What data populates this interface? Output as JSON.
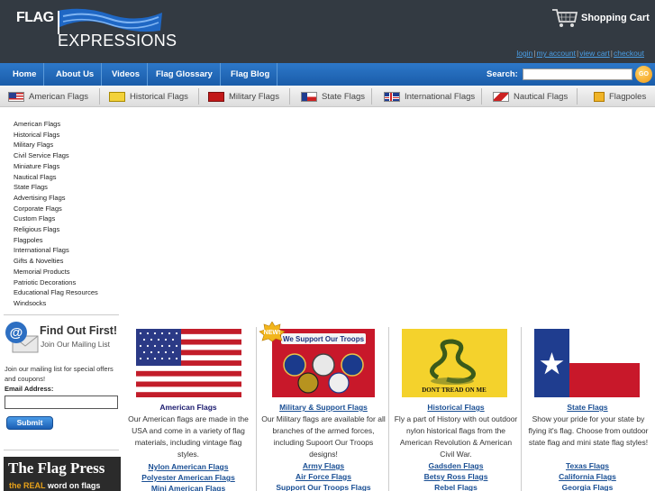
{
  "header": {
    "logo_top": "FLAG",
    "logo_bottom": "EXPRESSIONS",
    "cart_label": "Shopping Cart",
    "links": [
      "login",
      "my account",
      "view cart",
      "checkout"
    ]
  },
  "nav": {
    "items": [
      "Home",
      "About Us",
      "Videos",
      "Flag Glossary",
      "Flag Blog"
    ],
    "search_label": "Search:",
    "search_value": "",
    "go_label": "GO"
  },
  "categories": [
    "American Flags",
    "Historical Flags",
    "Military Flags",
    "State Flags",
    "International Flags",
    "Nautical Flags",
    "Flagpoles"
  ],
  "sidebar": {
    "items": [
      "American Flags",
      "Historical Flags",
      "Military Flags",
      "Civil Service Flags",
      "Miniature Flags",
      "Nautical Flags",
      "State Flags",
      "Advertising Flags",
      "Corporate Flags",
      "Custom Flags",
      "Religious Flags",
      "Flagpoles",
      "International Flags",
      "Gifts & Novelties",
      "Memorial Products",
      "Patriotic Decorations",
      "Educational Flag Resources",
      "Windsocks"
    ],
    "mailing": {
      "heading": "Find Out First!",
      "subheading": "Join Our Mailing List",
      "text": "Join our mailing list for special offers and coupons!",
      "email_label": "Email Address:",
      "email_value": "",
      "submit_label": "Submit"
    },
    "press": {
      "title": "The Flag Press",
      "tagline_prefix": "",
      "tagline_highlight": "the REAL",
      "tagline_suffix": " word on flags"
    }
  },
  "products": [
    {
      "title": "American Flags",
      "desc": "Our American flags are made in the USA and come in a variety of flag materials, including vintage flag styles.",
      "links": [
        "Nylon American Flags",
        "Polyester American Flags",
        "Mini American Flags"
      ]
    },
    {
      "title": "Military & Support Flags",
      "badge": "NEW!",
      "banner": "We Support Our Troops",
      "desc": "Our Military flags are available for all branches of the armed forces, including Supoort Our Troops designs!",
      "links": [
        "Army Flags",
        "Air Force Flags",
        "Support Our Troops Flags"
      ]
    },
    {
      "title": "Historical Flags",
      "banner": "DONT TREAD ON ME",
      "desc": "Fly a part of History with out outdoor nylon historical flags from the American Revolution & American Civil War.",
      "links": [
        "Gadsden Flags",
        "Betsy Ross Flags",
        "Rebel Flags"
      ]
    },
    {
      "title": "State Flags",
      "desc": "Show your pride for your state by flying it's flag. Choose from outdoor state flag and mini state flag styles!",
      "links": [
        "Texas Flags",
        "California Flags",
        "Georgia Flags"
      ]
    }
  ]
}
